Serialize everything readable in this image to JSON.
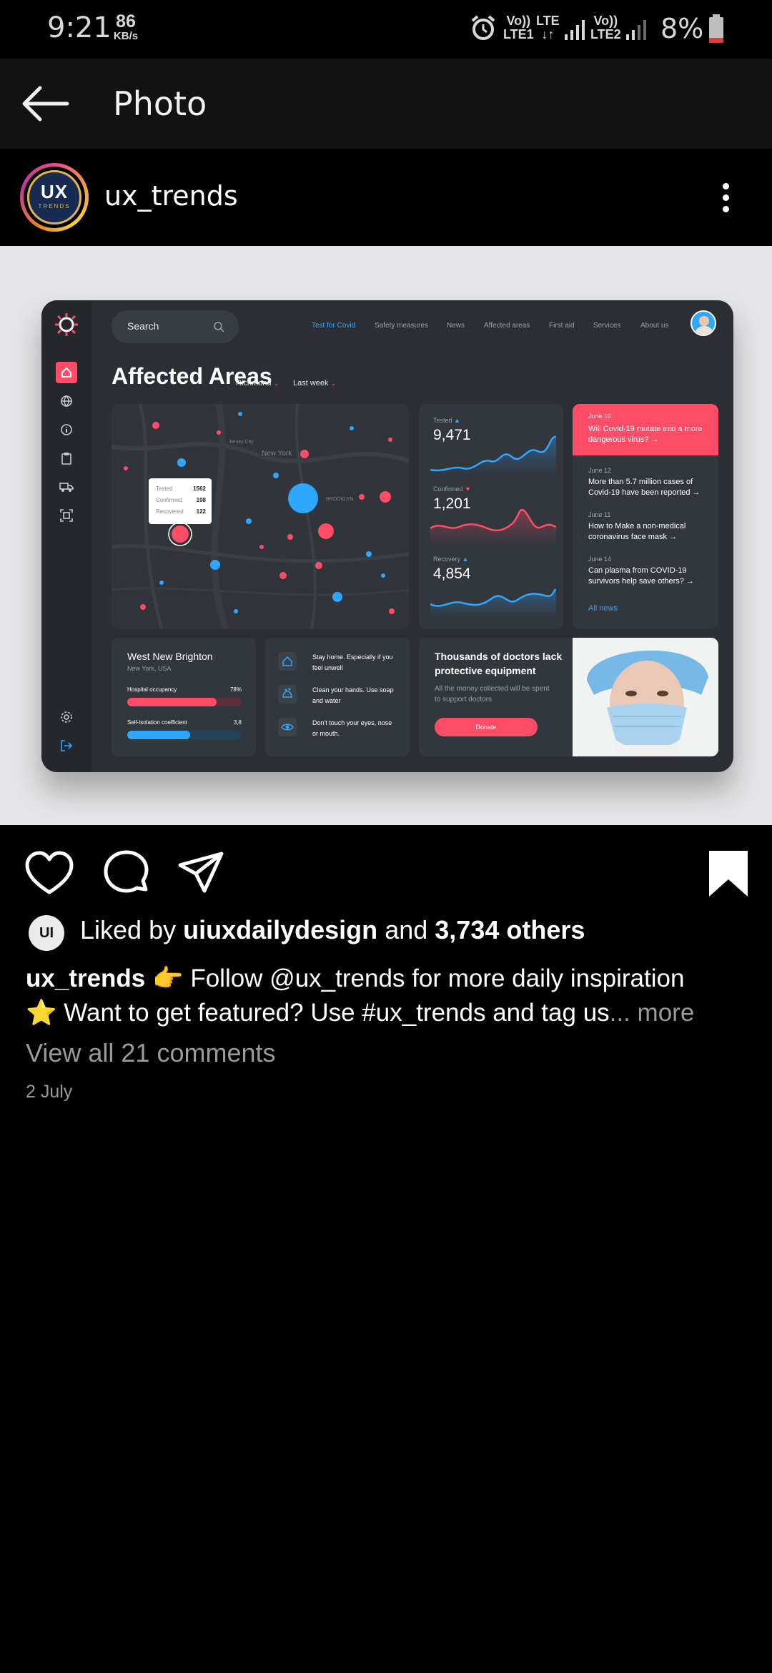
{
  "status_bar": {
    "time": "9:21",
    "net_speed": "86",
    "net_unit": "KB/s",
    "sim1_top": "Vo))",
    "sim1_bottom": "LTE1",
    "lte_top": "LTE",
    "lte_bottom": "↓↑",
    "sim2_top": "Vo))",
    "sim2_bottom": "LTE2",
    "battery": "8%",
    "icons": [
      "alarm-icon",
      "signal-icon",
      "battery-icon"
    ]
  },
  "app_bar": {
    "title": "Photo",
    "back_icon": "arrow-left-icon"
  },
  "post": {
    "username": "ux_trends",
    "avatar_text": "UX",
    "avatar_sub": "TRENDS"
  },
  "dashboard": {
    "search_placeholder": "Search",
    "nav": [
      "Test for Covid",
      "Safety measures",
      "News",
      "Affected areas",
      "First aid",
      "Services",
      "About us"
    ],
    "title": "Affected Areas",
    "location": "Richmond",
    "period": "Last week",
    "tooltip": {
      "rows": [
        {
          "label": "Tested",
          "value": "1562"
        },
        {
          "label": "Confirmed",
          "value": "198"
        },
        {
          "label": "Recovered",
          "value": "122"
        }
      ]
    },
    "stats": [
      {
        "label": "Tested",
        "value": "9,471"
      },
      {
        "label": "Confirmed",
        "value": "1,201"
      },
      {
        "label": "Recovery",
        "value": "4,854"
      }
    ],
    "news": [
      {
        "date": "June 10",
        "title": "Will Covid-19 mutate into a more dangerous virus? →"
      },
      {
        "date": "June 12",
        "title": "More than 5.7 million cases of Covid-19 have been reported →"
      },
      {
        "date": "June 11",
        "title": "How to Make a non-medical coronavirus face mask →"
      },
      {
        "date": "June 14",
        "title": "Can plasma from COVID-19 survivors help save others? →"
      }
    ],
    "all_news": "All news",
    "region": {
      "name": "West New Brighton",
      "sub": "New York, USA",
      "hospital_label": "Hospital occupancy",
      "hospital_value": "78%",
      "hospital_fraction": 0.78,
      "isolation_label": "Self-isolation coefficient",
      "isolation_value": "3,8",
      "isolation_fraction": 0.55
    },
    "tips": [
      "Stay home. Especially if you feel unwell",
      "Clean your hands. Use soap and water",
      "Don't touch your eyes, nose or mouth."
    ],
    "donate": {
      "title": "Thousands of doctors lack protective equipment",
      "sub": "All the money collected will be spent to support doctors",
      "button": "Donate"
    },
    "map_labels": [
      "New York",
      "BROOKLYN",
      "Jersey City"
    ],
    "colors": {
      "red": "#ff4d68",
      "blue": "#2ea7ff",
      "panel": "#32363d"
    }
  },
  "actions": {
    "icons": [
      "heart-icon",
      "comment-icon",
      "share-icon",
      "bookmark-icon"
    ]
  },
  "likes": {
    "avatar": "UI",
    "prefix": "Liked by",
    "user": "uiuxdailydesign",
    "and": "and",
    "count": "3,734 others"
  },
  "caption": {
    "user": "ux_trends",
    "line1": "👉 Follow @ux_trends for more daily inspiration",
    "line2": "⭐ Want to get featured? Use #ux_trends and tag us",
    "more": "... more"
  },
  "comments": "View all 21 comments",
  "date": "2 July"
}
